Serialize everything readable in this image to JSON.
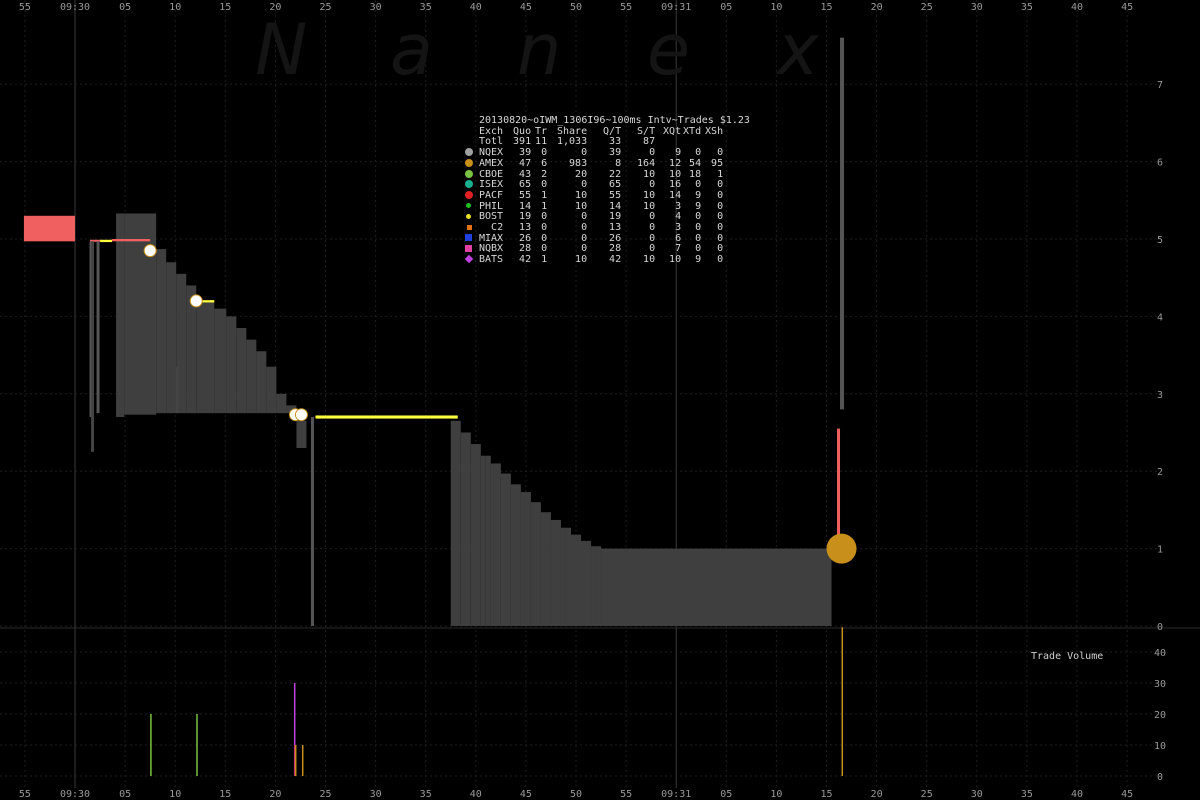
{
  "watermark": [
    "N",
    "a",
    "n",
    "e",
    "x"
  ],
  "stats": {
    "title": "20130820~oIWM_1306I96~100ms Intv~Trades $1.23",
    "headers": [
      "Exch",
      "Quo",
      "Tr",
      "Share",
      "Q/T",
      "S/T",
      "XQt",
      "XTd",
      "XSh"
    ],
    "total": [
      "Totl",
      "391",
      "11",
      "1,033",
      "33",
      "87",
      "",
      "",
      ""
    ],
    "rows": [
      {
        "icon": "dot",
        "color": "#a0a0a0",
        "cells": [
          "NQEX",
          "39",
          "0",
          "0",
          "39",
          "0",
          "9",
          "0",
          "0"
        ]
      },
      {
        "icon": "dot",
        "color": "#c8901a",
        "cells": [
          "AMEX",
          "47",
          "6",
          "983",
          "8",
          "164",
          "12",
          "54",
          "95"
        ]
      },
      {
        "icon": "dot",
        "color": "#7ac142",
        "cells": [
          "CBOE",
          "43",
          "2",
          "20",
          "22",
          "10",
          "10",
          "18",
          "1"
        ]
      },
      {
        "icon": "dot",
        "color": "#18b090",
        "cells": [
          "ISEX",
          "65",
          "0",
          "0",
          "65",
          "0",
          "16",
          "0",
          "0"
        ]
      },
      {
        "icon": "dot",
        "color": "#e02020",
        "cells": [
          "PACF",
          "55",
          "1",
          "10",
          "55",
          "10",
          "14",
          "9",
          "0"
        ]
      },
      {
        "icon": "small",
        "color": "#20c020",
        "cells": [
          "PHIL",
          "14",
          "1",
          "10",
          "14",
          "10",
          "3",
          "9",
          "0"
        ]
      },
      {
        "icon": "small",
        "color": "#e8e020",
        "cells": [
          "BOST",
          "19",
          "0",
          "0",
          "19",
          "0",
          "4",
          "0",
          "0"
        ]
      },
      {
        "icon": "small-square",
        "color": "#e07010",
        "cells": [
          "C2",
          "13",
          "0",
          "0",
          "13",
          "0",
          "3",
          "0",
          "0"
        ]
      },
      {
        "icon": "square",
        "color": "#2040e0",
        "cells": [
          "MIAX",
          "26",
          "0",
          "0",
          "26",
          "0",
          "6",
          "0",
          "0"
        ]
      },
      {
        "icon": "square",
        "color": "#e040a0",
        "cells": [
          "NQBX",
          "28",
          "0",
          "0",
          "28",
          "0",
          "7",
          "0",
          "0"
        ]
      },
      {
        "icon": "diamond",
        "color": "#c040e0",
        "cells": [
          "BATS",
          "42",
          "1",
          "10",
          "42",
          "10",
          "10",
          "9",
          "0"
        ]
      }
    ]
  },
  "volume_label": "Trade Volume",
  "chart_data": {
    "type": "area",
    "x_unit": "seconds",
    "x_range": [
      -5,
      76.3
    ],
    "x_minor_ticks": [
      "55",
      "09:30",
      "05",
      "10",
      "15",
      "20",
      "25",
      "30",
      "35",
      "40",
      "45",
      "50",
      "55",
      "09:31",
      "05",
      "10",
      "15",
      "20",
      "25",
      "30",
      "35",
      "40",
      "45"
    ],
    "x_tick_values": [
      -5,
      0,
      5,
      10,
      15,
      20,
      25,
      30,
      35,
      40,
      45,
      50,
      55,
      60,
      65,
      70,
      75,
      80,
      85,
      90,
      95,
      100,
      105
    ],
    "price_axis": {
      "ticks": [
        0,
        1,
        2,
        3,
        4,
        5,
        6,
        7
      ],
      "range": [
        0,
        7.6
      ]
    },
    "volume_axis": {
      "ticks": [
        0,
        10,
        20,
        30,
        40
      ],
      "range": [
        0,
        49
      ]
    },
    "bid": [
      [
        4.1,
        2.7
      ],
      [
        4.9,
        2.73
      ],
      [
        8.1,
        2.75
      ],
      [
        10.1,
        2.75
      ],
      [
        12.1,
        2.75
      ],
      [
        13.9,
        2.75
      ],
      [
        15.1,
        2.75
      ],
      [
        20.1,
        2.75
      ],
      [
        22.1,
        2.3
      ],
      [
        23.1,
        0
      ],
      [
        37.5,
        0
      ],
      [
        41,
        0
      ],
      [
        46.5,
        0
      ],
      [
        52,
        0
      ],
      [
        75.5,
        0
      ]
    ],
    "ask": [
      [
        4.1,
        5.33
      ],
      [
        4.9,
        5.33
      ],
      [
        8.1,
        4.87
      ],
      [
        9.1,
        4.7
      ],
      [
        10.1,
        4.55
      ],
      [
        11.1,
        4.4
      ],
      [
        12.1,
        4.2
      ],
      [
        13.9,
        4.1
      ],
      [
        15.1,
        4.0
      ],
      [
        16.1,
        3.85
      ],
      [
        17.1,
        3.7
      ],
      [
        18.1,
        3.55
      ],
      [
        19.1,
        3.35
      ],
      [
        20.1,
        3.0
      ],
      [
        21.1,
        2.85
      ],
      [
        22.1,
        2.65
      ],
      [
        23.1,
        2.65
      ],
      [
        37.5,
        2.65
      ],
      [
        38.5,
        2.5
      ],
      [
        39.5,
        2.35
      ],
      [
        40.5,
        2.2
      ],
      [
        41.5,
        2.1
      ],
      [
        42.5,
        1.97
      ],
      [
        43.5,
        1.83
      ],
      [
        44.5,
        1.73
      ],
      [
        45.5,
        1.6
      ],
      [
        46.5,
        1.47
      ],
      [
        47.5,
        1.37
      ],
      [
        48.5,
        1.27
      ],
      [
        49.5,
        1.18
      ],
      [
        50.5,
        1.1
      ],
      [
        51.5,
        1.03
      ],
      [
        52.5,
        1.0
      ],
      [
        75.5,
        1.0
      ]
    ],
    "nbbo_bands": [
      {
        "x0": -5.1,
        "x1": 0,
        "lo": 4.97,
        "hi": 5.3,
        "color": "#f06060"
      },
      {
        "x0": 1.5,
        "x1": 2.5,
        "lo": 4.97,
        "hi": 4.99,
        "color": "#f06060"
      },
      {
        "x0": 2.5,
        "x1": 3.7,
        "lo": 4.96,
        "hi": 4.99,
        "color": "#ffff40"
      },
      {
        "x0": 3.7,
        "x1": 7.5,
        "lo": 4.97,
        "hi": 5.0,
        "color": "#f06060"
      },
      {
        "x0": 12.1,
        "x1": 13.9,
        "lo": 4.18,
        "hi": 4.21,
        "color": "#ffff40"
      },
      {
        "x0": 24.0,
        "x1": 38.2,
        "lo": 2.68,
        "hi": 2.72,
        "color": "#ffff40"
      }
    ],
    "spikes": [
      {
        "x": 1.6,
        "lo": 2.7,
        "hi": 4.97,
        "color": "#555555"
      },
      {
        "x": 1.75,
        "lo": 2.25,
        "hi": 4.97,
        "color": "#444444"
      },
      {
        "x": 2.3,
        "lo": 2.75,
        "hi": 4.97,
        "color": "#555555"
      },
      {
        "x": 10.2,
        "lo": 2.75,
        "hi": 3.35,
        "color": "#444444"
      },
      {
        "x": 23.7,
        "lo": 0,
        "hi": 2.7,
        "color": "#555555"
      },
      {
        "x": 76.5,
        "lo": 2.8,
        "hi": 7.6,
        "color": "#555555"
      },
      {
        "x": 76.6,
        "lo": 2.8,
        "hi": 7.6,
        "color": "#555555"
      },
      {
        "x": 76.2,
        "lo": 1.0,
        "hi": 2.55,
        "color": "#f06060"
      }
    ],
    "trades": [
      {
        "x": 7.5,
        "price": 4.85,
        "size": 6,
        "color": "#ffffff"
      },
      {
        "x": 12.1,
        "price": 4.2,
        "size": 6,
        "color": "#ffffff"
      },
      {
        "x": 22.0,
        "price": 2.73,
        "size": 6,
        "color": "#ffffff"
      },
      {
        "x": 22.6,
        "price": 2.73,
        "size": 6,
        "color": "#ffffff"
      },
      {
        "x": 76.5,
        "price": 1.0,
        "size": 14,
        "color": "#c8901a"
      }
    ],
    "volume": [
      {
        "x": 7.55,
        "value": 20,
        "color": "#7ac142"
      },
      {
        "x": 12.15,
        "value": 20,
        "color": "#7ac142"
      },
      {
        "x": 21.9,
        "value": 30,
        "color": "#c040e0"
      },
      {
        "x": 21.95,
        "value": 10,
        "color": "#e02020"
      },
      {
        "x": 22.0,
        "value": 10,
        "color": "#c8901a"
      },
      {
        "x": 22.7,
        "value": 10,
        "color": "#c8901a"
      },
      {
        "x": 76.55,
        "value": 48,
        "color": "#c8901a"
      }
    ]
  }
}
